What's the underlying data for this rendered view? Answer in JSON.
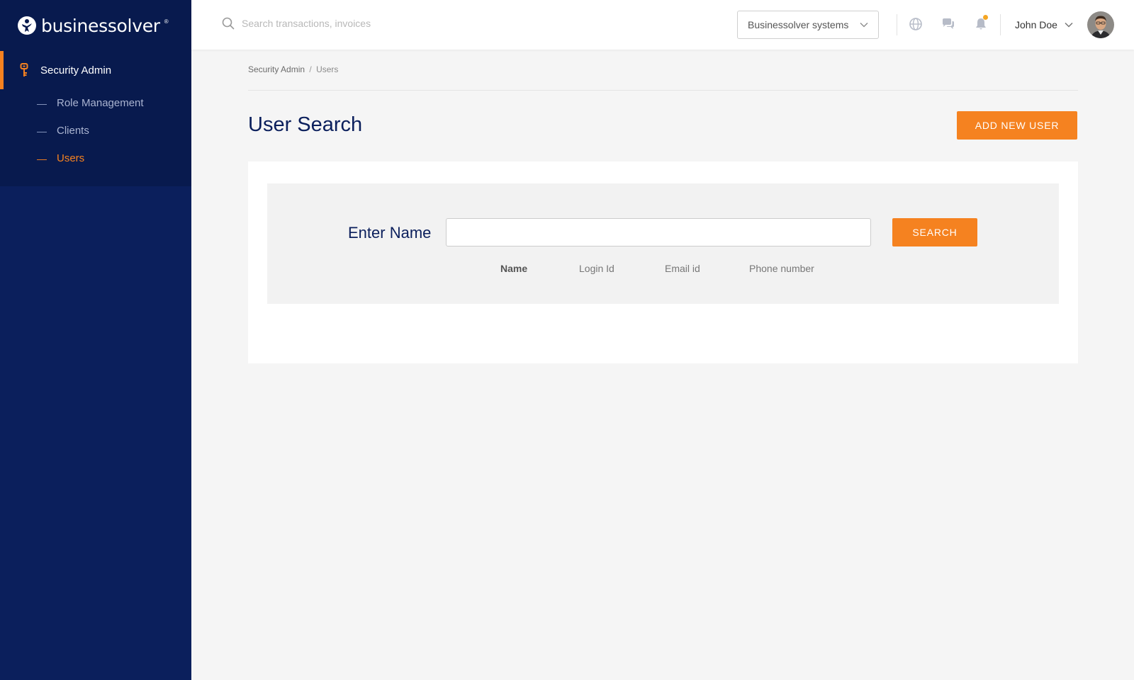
{
  "brand": {
    "name": "businessolver",
    "tm": "®"
  },
  "sidebar": {
    "section": "Security Admin",
    "items": [
      {
        "label": "Role Management",
        "active": false
      },
      {
        "label": "Clients",
        "active": false
      },
      {
        "label": "Users",
        "active": true
      }
    ]
  },
  "topbar": {
    "search_placeholder": "Search transactions, invoices",
    "org_select_value": "Businessolver systems",
    "icons": [
      "globe-icon",
      "chat-icon",
      "bell-icon"
    ],
    "user_name": "John Doe"
  },
  "breadcrumb": {
    "parent": "Security Admin",
    "separator": "/",
    "current": "Users"
  },
  "page": {
    "title": "User Search",
    "add_button": "ADD NEW USER"
  },
  "search_form": {
    "label": "Enter Name",
    "input_value": "",
    "button": "SEARCH",
    "filters": [
      {
        "label": "Name",
        "selected": true
      },
      {
        "label": "Login Id",
        "selected": false
      },
      {
        "label": "Email id",
        "selected": false
      },
      {
        "label": "Phone number",
        "selected": false
      }
    ]
  },
  "colors": {
    "sidebar_bg": "#0b1f5c",
    "accent": "#f58220",
    "title": "#0b1f5c"
  }
}
